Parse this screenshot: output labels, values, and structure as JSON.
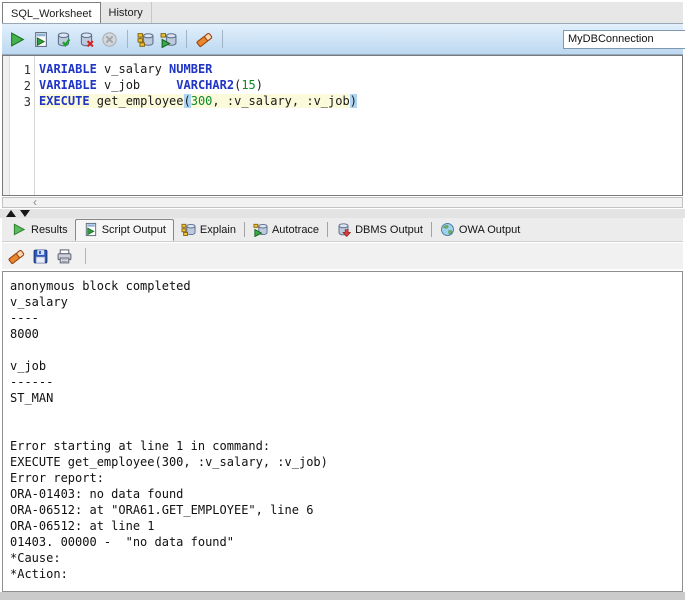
{
  "colors": {
    "kw": "#1f35c5",
    "num": "#0b8a28",
    "hl": "#fbfada",
    "paren": "#aed5f2",
    "toolbar_blue": "#cbe2f5",
    "run_green": "#46b14e"
  },
  "glyphs": {
    "scroll_left": "‹"
  },
  "top_tabs": [
    {
      "label": "SQL_Worksheet",
      "active": true
    },
    {
      "label": "History",
      "active": false
    }
  ],
  "toolbar": {
    "connection_value": "MyDBConnection",
    "buttons": [
      {
        "name": "run-statement",
        "icon": "run-icon",
        "enabled": true
      },
      {
        "name": "run-script",
        "icon": "run-script-icon",
        "enabled": true
      },
      {
        "name": "commit",
        "icon": "commit-icon",
        "enabled": true
      },
      {
        "name": "rollback",
        "icon": "rollback-icon",
        "enabled": true
      },
      {
        "name": "cancel",
        "icon": "cancel-icon",
        "enabled": false
      },
      {
        "name": "separator"
      },
      {
        "name": "explain-plan",
        "icon": "explain-plan-icon",
        "enabled": true
      },
      {
        "name": "autotrace",
        "icon": "autotrace-icon",
        "enabled": true
      },
      {
        "name": "separator"
      },
      {
        "name": "clear",
        "icon": "eraser-icon",
        "enabled": true
      },
      {
        "name": "separator"
      }
    ]
  },
  "editor": {
    "lines": [
      {
        "number": "1",
        "highlighted": false,
        "segments": [
          {
            "t": "VARIABLE",
            "c": "kw"
          },
          {
            "t": " v_salary ",
            "c": "plain"
          },
          {
            "t": "NUMBER",
            "c": "kw"
          }
        ]
      },
      {
        "number": "2",
        "highlighted": false,
        "segments": [
          {
            "t": "VARIABLE",
            "c": "kw"
          },
          {
            "t": " v_job     ",
            "c": "plain"
          },
          {
            "t": "VARCHAR2",
            "c": "kw"
          },
          {
            "t": "(",
            "c": "plain"
          },
          {
            "t": "15",
            "c": "num"
          },
          {
            "t": ")",
            "c": "plain"
          }
        ]
      },
      {
        "number": "3",
        "highlighted": true,
        "segments": [
          {
            "t": "EXECUTE",
            "c": "kw"
          },
          {
            "t": " get_employee",
            "c": "plain"
          },
          {
            "t": "(",
            "c": "paren"
          },
          {
            "t": "300",
            "c": "num"
          },
          {
            "t": ", :v_salary, :v_job",
            "c": "plain"
          },
          {
            "t": ")",
            "c": "paren"
          }
        ]
      }
    ]
  },
  "output_panel": {
    "tabs": [
      {
        "label": "Results",
        "icon": "results-icon",
        "active": false
      },
      {
        "label": "Script Output",
        "icon": "script-output-icon",
        "active": true
      },
      {
        "label": "Explain",
        "icon": "explain-icon",
        "active": false
      },
      {
        "label": "Autotrace",
        "icon": "autotrace-icon",
        "active": false
      },
      {
        "label": "DBMS Output",
        "icon": "dbms-output-icon",
        "active": false
      },
      {
        "label": "OWA Output",
        "icon": "owa-output-icon",
        "active": false
      }
    ],
    "toolbar": [
      {
        "name": "clear-output",
        "icon": "eraser-icon"
      },
      {
        "name": "save-output",
        "icon": "save-icon"
      },
      {
        "name": "print-output",
        "icon": "printer-icon"
      }
    ],
    "script_output_lines": [
      "anonymous block completed",
      "v_salary",
      "----",
      "8000",
      "",
      "v_job",
      "------",
      "ST_MAN",
      "",
      "",
      "Error starting at line 1 in command:",
      "EXECUTE get_employee(300, :v_salary, :v_job)",
      "Error report:",
      "ORA-01403: no data found",
      "ORA-06512: at \"ORA61.GET_EMPLOYEE\", line 6",
      "ORA-06512: at line 1",
      "01403. 00000 -  \"no data found\"",
      "*Cause:",
      "*Action:"
    ]
  }
}
